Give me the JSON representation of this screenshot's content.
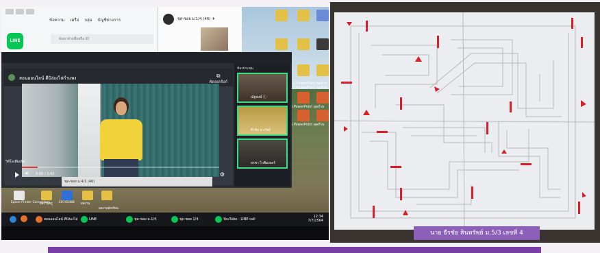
{
  "line_window": {
    "logo_text": "LINE",
    "tabs": [
      "ข้อความ",
      "เครือ",
      "กลุ่ม",
      "บัญชีทางการ"
    ],
    "search_placeholder": "ค้นหาด้วยชื่อหรือ ID"
  },
  "call_window": {
    "title": "ชุด-ซอย ม.1/4 (46) ✈"
  },
  "video": {
    "header_title": "สอนออนไลน์ ดีปัง่องไล่กำแพง",
    "copy_link_label": "คัดลอกลิงก์",
    "captions_label": "วิดีโอเพิ่มเติม",
    "time_label": "0:00 / 3:42",
    "progress": 0.08
  },
  "participants": {
    "title": "ห้องประชุม",
    "tiles": [
      {
        "name": "ณัฐพงษ์ ⓘ"
      },
      {
        "name": "ธีรชัย อาภัพย์"
      },
      {
        "name": "อรชา ไวพิมเธอร์"
      }
    ]
  },
  "overlay_text": "ชุด-ซอย ม.4/1 (46)",
  "desktop_icons": [
    {
      "label": "5.PowerPoint สุดท้าย"
    },
    {
      "label": "5.PowerPoint สุดท้าย"
    },
    {
      "label": "4.PowerPoint สุดท้าย"
    },
    {
      "label": "3.PowerPoint สุดท้าย"
    }
  ],
  "row_icons": [
    {
      "label": "Epson Printer Connection"
    },
    {
      "label": "ผลงานครู"
    },
    {
      "label": "E0745488"
    },
    {
      "label": "ผลงาน"
    },
    {
      "label": "ผลงานนักเรียน"
    }
  ],
  "taskbar": {
    "buttons": [
      {
        "label": "สอนออนไลน์ ดีปัง่องไล่"
      },
      {
        "label": "LINE"
      },
      {
        "label": "ชุด-ซอย ม.1/4"
      },
      {
        "label": "ชุด-ซอย 1/4"
      },
      {
        "label": "YouTube - LINE call"
      }
    ],
    "clock_time": "12:34",
    "clock_date": "7/7/2564"
  },
  "caption": "นาย ธีรชัย สินทรัพย์ ม.5/3 เลขที่ 4",
  "colors": {
    "marker_red": "#d81f2a",
    "caption_bg": "#8c5fb8",
    "line_green": "#06c755"
  }
}
